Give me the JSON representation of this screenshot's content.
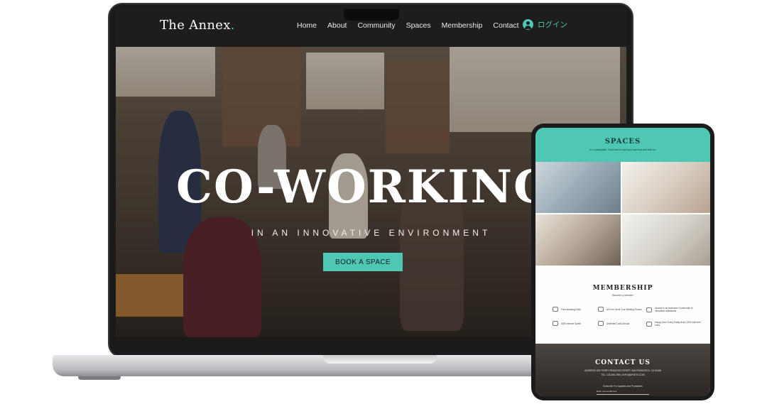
{
  "site": {
    "brand_name": "The Annex",
    "brand_dot": ".",
    "nav": [
      "Home",
      "About",
      "Community",
      "Spaces",
      "Membership",
      "Contact"
    ],
    "login_label": "ログイン",
    "hero": {
      "title": "CO-WORKING",
      "subtitle": "IN AN INNOVATIVE ENVIRONMENT",
      "cta": "BOOK A SPACE"
    }
  },
  "tablet": {
    "spaces": {
      "title": "SPACES",
      "subtitle": "I'm a paragraph. Click here to add your own text and edit me."
    },
    "membership": {
      "title": "MEMBERSHIP",
      "subtitle": "Become a member",
      "features": [
        {
          "icon": "laptop-icon",
          "label": "Free-standing Desk"
        },
        {
          "icon": "meeting-icon",
          "label": "All Free Drink Your Meeting Rooms"
        },
        {
          "icon": "community-icon",
          "label": "Access to an Awesome Community of innovative individuals"
        },
        {
          "icon": "wifi-icon",
          "label": "3GB Internet Speed"
        },
        {
          "icon": "phone-icon",
          "label": "Unlimited Calls Abroad"
        },
        {
          "icon": "coffee-icon",
          "label": "Happy Hour Every Friday from 18:00 with free entry"
        }
      ]
    },
    "contact": {
      "title": "CONTACT US",
      "address": "ADDRESS: 500 TERRY FRANCOIS STREET SAN FRANCISCO, CA 94158",
      "phone_email": "TEL: 123-456-7890 | INFO@MYSITE.COM",
      "subscribe": "Subscribe For Updates and Promotions",
      "email_placeholder": "Enter your email here"
    }
  },
  "colors": {
    "accent": "#4ec7b4",
    "nav_bg": "#1d1d1d"
  }
}
